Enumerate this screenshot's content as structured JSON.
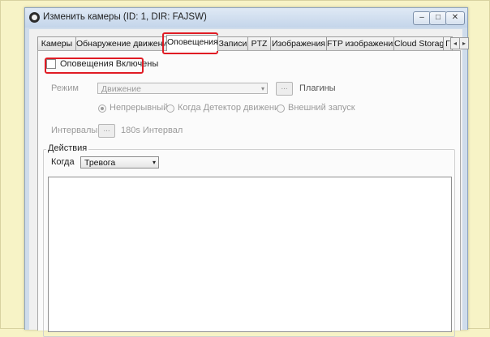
{
  "window": {
    "title": "Изменить камеры (ID: 1, DIR: FAJSW)",
    "minimize_glyph": "–",
    "maximize_glyph": "□",
    "close_glyph": "✕"
  },
  "tabs": [
    {
      "label": "Камеры"
    },
    {
      "label": "Обнаружение движения"
    },
    {
      "label": "Оповещения",
      "active": true
    },
    {
      "label": "Записи"
    },
    {
      "label": "PTZ"
    },
    {
      "label": "Изображения"
    },
    {
      "label": "FTP изображения"
    },
    {
      "label": "Cloud Storage"
    },
    {
      "label": "Г"
    }
  ],
  "tab_scroll": {
    "left": "◂",
    "right": "▸"
  },
  "alerts": {
    "enabled_label": "Оповещения Включены",
    "enabled": false,
    "mode_label": "Режим",
    "mode_value": "Движение",
    "mode_caret": "▾",
    "plugins_button": "...",
    "plugins_label": "Плагины",
    "trigger_options": [
      {
        "label": "Непрерывный",
        "selected": true
      },
      {
        "label": "Когда Детектор движения",
        "selected": false
      },
      {
        "label": "Внешний запуск",
        "selected": false
      }
    ],
    "interval_label": "Интервалы",
    "interval_button": "...",
    "interval_value": "180s Интервал"
  },
  "actions": {
    "group_title": "Действия",
    "when_label": "Когда",
    "when_value": "Тревога",
    "when_caret": "▾"
  },
  "colors": {
    "highlight": "#e01b24",
    "background": "#f7f3c6",
    "titlebar": "#cfdceb"
  }
}
